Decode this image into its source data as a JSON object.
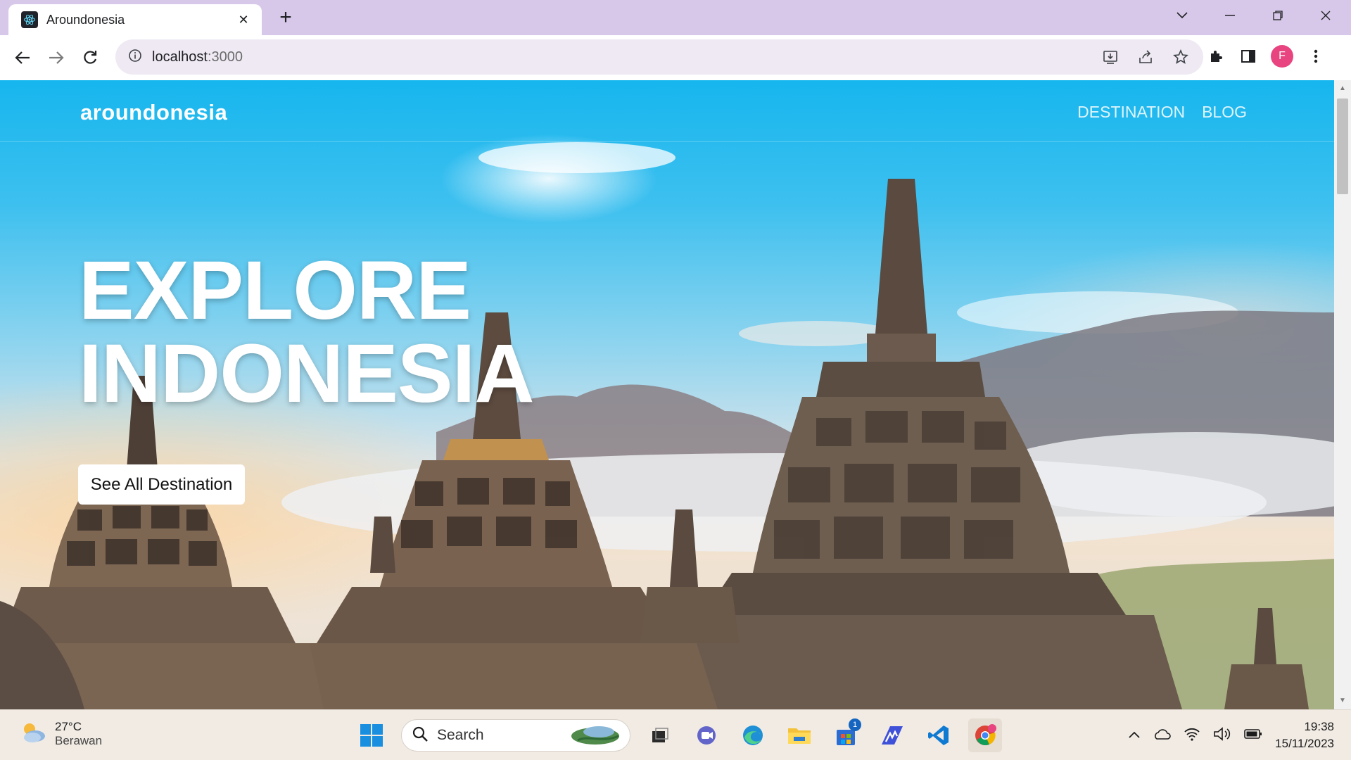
{
  "browser": {
    "tab_title": "Aroundonesia",
    "url_host": "localhost",
    "url_port": ":3000",
    "profile_initial": "F"
  },
  "site": {
    "brand": "aroundonesia",
    "nav": [
      "DESTINATION",
      "BLOG"
    ],
    "hero_line1": "EXPLORE",
    "hero_line2": "INDONESIA",
    "cta_label": "See All Destination"
  },
  "taskbar": {
    "temperature": "27°C",
    "condition": "Berawan",
    "search_placeholder": "Search",
    "store_badge": "1",
    "time": "19:38",
    "date": "15/11/2023"
  },
  "colors": {
    "tabbar": "#d7c8e9",
    "avatar": "#e8447f",
    "sky": "#16b6ee"
  }
}
